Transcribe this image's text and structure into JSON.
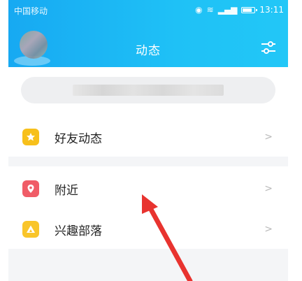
{
  "status_bar": {
    "carrier": "中国移动",
    "time": "13:11"
  },
  "header": {
    "title": "动态"
  },
  "menu": [
    {
      "label": "好友动态",
      "icon": "star-icon",
      "color": "#f7c01b"
    },
    {
      "label": "附近",
      "icon": "location-pin-icon",
      "color": "#f05c67"
    },
    {
      "label": "兴趣部落",
      "icon": "triangle-icon",
      "color": "#f9c52a"
    }
  ],
  "colors": {
    "header": "#1fb8f5",
    "arrow": "#e8332f"
  }
}
